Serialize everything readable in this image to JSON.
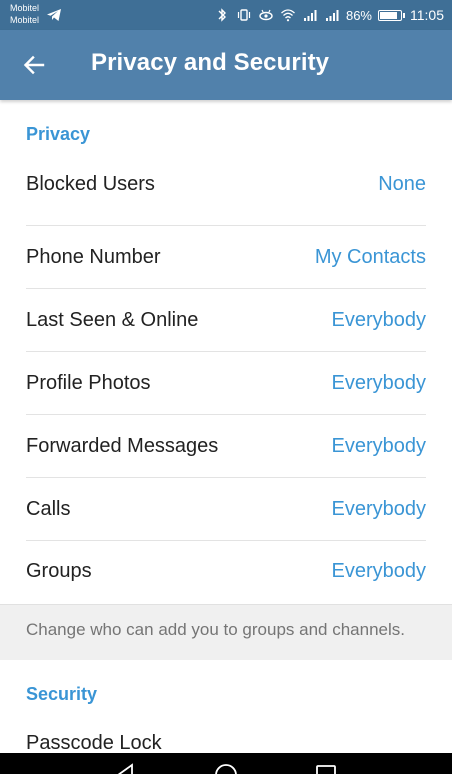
{
  "status_bar": {
    "carrier_1": "Mobitel",
    "carrier_2": "Mobitel",
    "battery": "86%",
    "time": "11:05"
  },
  "toolbar": {
    "title": "Privacy and Security"
  },
  "privacy": {
    "header": "Privacy",
    "items": [
      {
        "label": "Blocked Users",
        "value": "None"
      },
      {
        "label": "Phone Number",
        "value": "My Contacts"
      },
      {
        "label": "Last Seen & Online",
        "value": "Everybody"
      },
      {
        "label": "Profile Photos",
        "value": "Everybody"
      },
      {
        "label": "Forwarded Messages",
        "value": "Everybody"
      },
      {
        "label": "Calls",
        "value": "Everybody"
      },
      {
        "label": "Groups",
        "value": "Everybody"
      }
    ],
    "info": "Change who can add you to groups and channels."
  },
  "security": {
    "header": "Security",
    "items": [
      {
        "label": "Passcode Lock"
      }
    ]
  },
  "colors": {
    "status_bar": "#3f6f96",
    "toolbar": "#5181ab",
    "accent": "#3a95d5",
    "text": "#222222",
    "info_bg": "#f0f0f0"
  }
}
